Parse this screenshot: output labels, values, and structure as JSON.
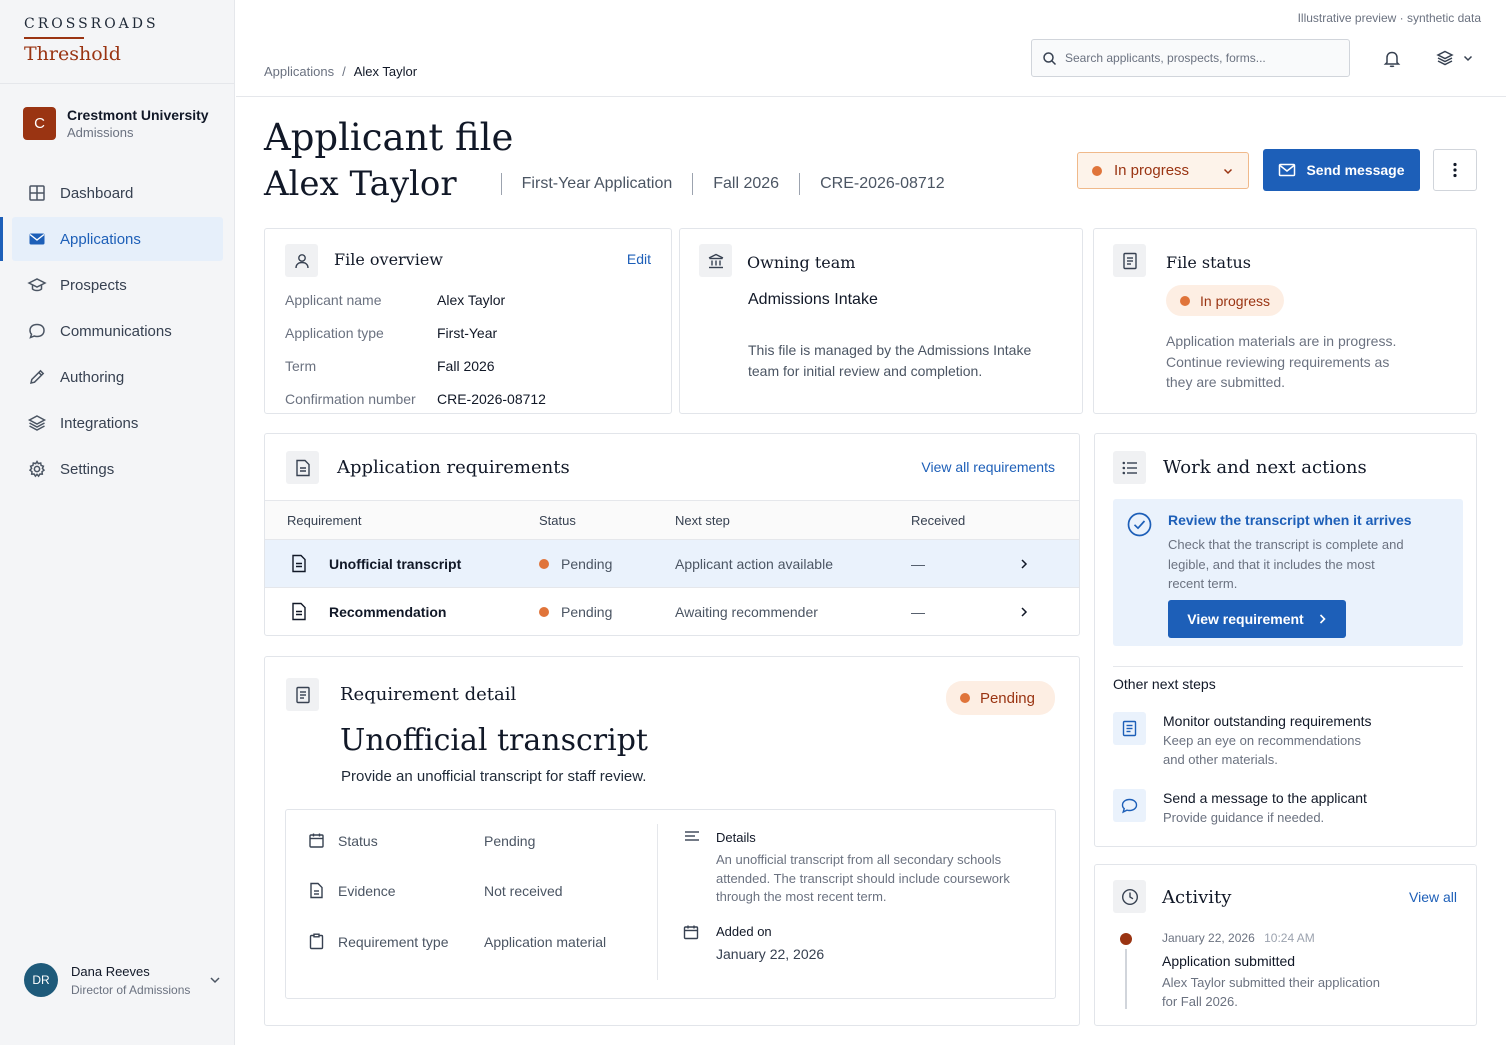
{
  "brand": {
    "top": "CROSSROADS",
    "name": "Threshold"
  },
  "org": {
    "initial": "C",
    "name": "Crestmont University",
    "sub": "Admissions"
  },
  "nav": [
    {
      "label": "Dashboard",
      "icon": "grid-icon"
    },
    {
      "label": "Applications",
      "icon": "mail-icon",
      "active": true
    },
    {
      "label": "Prospects",
      "icon": "graduation-cap-icon"
    },
    {
      "label": "Communications",
      "icon": "chat-bubble-icon"
    },
    {
      "label": "Authoring",
      "icon": "pencil-icon"
    },
    {
      "label": "Integrations",
      "icon": "layers-icon"
    },
    {
      "label": "Settings",
      "icon": "gear-icon"
    }
  ],
  "user": {
    "initials": "DR",
    "name": "Dana Reeves",
    "role": "Director of Admissions"
  },
  "header": {
    "preview_note": "Illustrative preview · synthetic data",
    "breadcrumb": {
      "root": "Applications",
      "sep": "/",
      "current": "Alex Taylor"
    },
    "search_placeholder": "Search applicants, prospects, forms..."
  },
  "page": {
    "label": "Applicant file",
    "name": "Alex Taylor",
    "meta": [
      "First-Year Application",
      "Fall 2026",
      "CRE-2026-08712"
    ],
    "status": "In progress",
    "send_label": "Send message"
  },
  "overview": {
    "title": "File overview",
    "edit": "Edit",
    "rows": [
      {
        "k": "Applicant name",
        "v": "Alex Taylor"
      },
      {
        "k": "Application type",
        "v": "First-Year"
      },
      {
        "k": "Term",
        "v": "Fall 2026"
      },
      {
        "k": "Confirmation number",
        "v": "CRE-2026-08712"
      }
    ]
  },
  "owning": {
    "title": "Owning team",
    "team": "Admissions Intake",
    "desc_1": "This file is managed by the Admissions Intake",
    "desc_2": "team for initial review and completion."
  },
  "file_status": {
    "title": "File status",
    "pill": "In progress",
    "desc_1": "Application materials are in progress.",
    "desc_2": "Continue reviewing requirements as",
    "desc_3": "they are submitted."
  },
  "requirements": {
    "title": "Application requirements",
    "view_all": "View all requirements",
    "columns": [
      "Requirement",
      "Status",
      "Next step",
      "Received"
    ],
    "rows": [
      {
        "name": "Unofficial transcript",
        "status": "Pending",
        "next": "Applicant action available",
        "received": "—"
      },
      {
        "name": "Recommendation",
        "status": "Pending",
        "next": "Awaiting recommender",
        "received": "—"
      }
    ]
  },
  "detail": {
    "title": "Requirement detail",
    "pill": "Pending",
    "heading": "Unofficial transcript",
    "subtitle": "Provide an unofficial transcript for staff review.",
    "rows": [
      {
        "k": "Status",
        "v": "Pending"
      },
      {
        "k": "Evidence",
        "v": "Not received"
      },
      {
        "k": "Requirement type",
        "v": "Application material"
      }
    ],
    "details_label": "Details",
    "details_1": "An unofficial transcript from all secondary schools",
    "details_2": "attended. The transcript should include coursework",
    "details_3": "through the most recent term.",
    "added_label": "Added on",
    "added_value": "January 22, 2026"
  },
  "work": {
    "title": "Work and next actions",
    "task_title": "Review the transcript when it arrives",
    "task_1": "Check that the transcript is complete and",
    "task_2": "legible, and that it includes the most",
    "task_3": "recent term.",
    "task_button": "View requirement",
    "other_label": "Other next steps",
    "steps": [
      {
        "title": "Monitor outstanding requirements",
        "d1": "Keep an eye on recommendations",
        "d2": "and other materials."
      },
      {
        "title": "Send a message to the applicant",
        "d1": "Provide guidance if needed.",
        "d2": ""
      }
    ]
  },
  "activity": {
    "title": "Activity",
    "view_all": "View all",
    "date": "January 22, 2026",
    "time": "10:24 AM",
    "event": "Application submitted",
    "d1": "Alex Taylor submitted their application",
    "d2": "for Fall 2026."
  },
  "colors": {
    "accent": "#1d5fb8",
    "brand": "#9a3412",
    "pending": "#e0743a"
  }
}
